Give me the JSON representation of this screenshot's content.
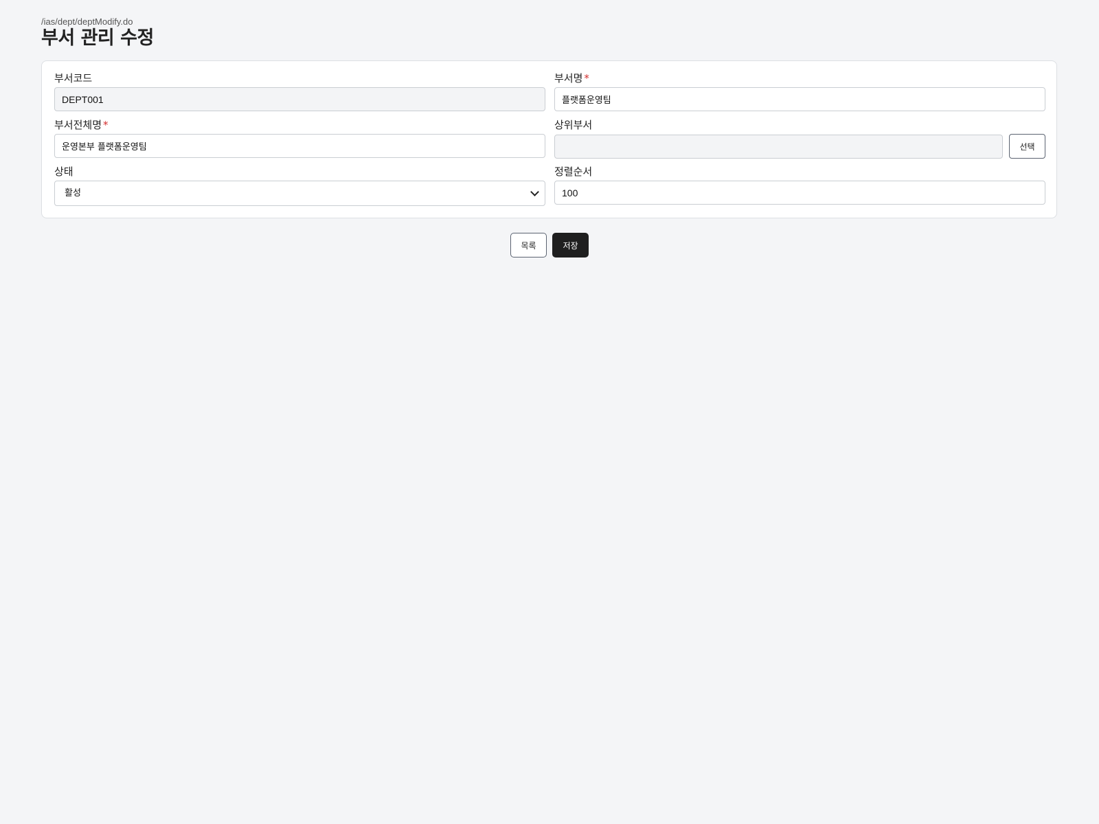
{
  "header": {
    "path": "/ias/dept/deptModify.do",
    "title": "부서 관리 수정"
  },
  "form": {
    "dept_code": {
      "label": "부서코드",
      "value": "DEPT001",
      "required": false,
      "readonly": true
    },
    "dept_name": {
      "label": "부서명",
      "value": "플랫폼운영팀",
      "required": true
    },
    "dept_full_name": {
      "label": "부서전체명",
      "value": "운영본부 플랫폼운영팀",
      "required": true
    },
    "parent_dept": {
      "label": "상위부서",
      "value": "",
      "readonly": true,
      "select_button": "선택"
    },
    "status": {
      "label": "상태",
      "selected": "활성"
    },
    "sort_order": {
      "label": "정렬순서",
      "value": "100"
    },
    "required_mark": "*"
  },
  "actions": {
    "list_label": "목록",
    "save_label": "저장"
  },
  "colors": {
    "background": "#f4f5f7",
    "required": "#d32f2f",
    "primary_button": "#1f1f1f",
    "readonly_field": "#f3f4f6"
  }
}
